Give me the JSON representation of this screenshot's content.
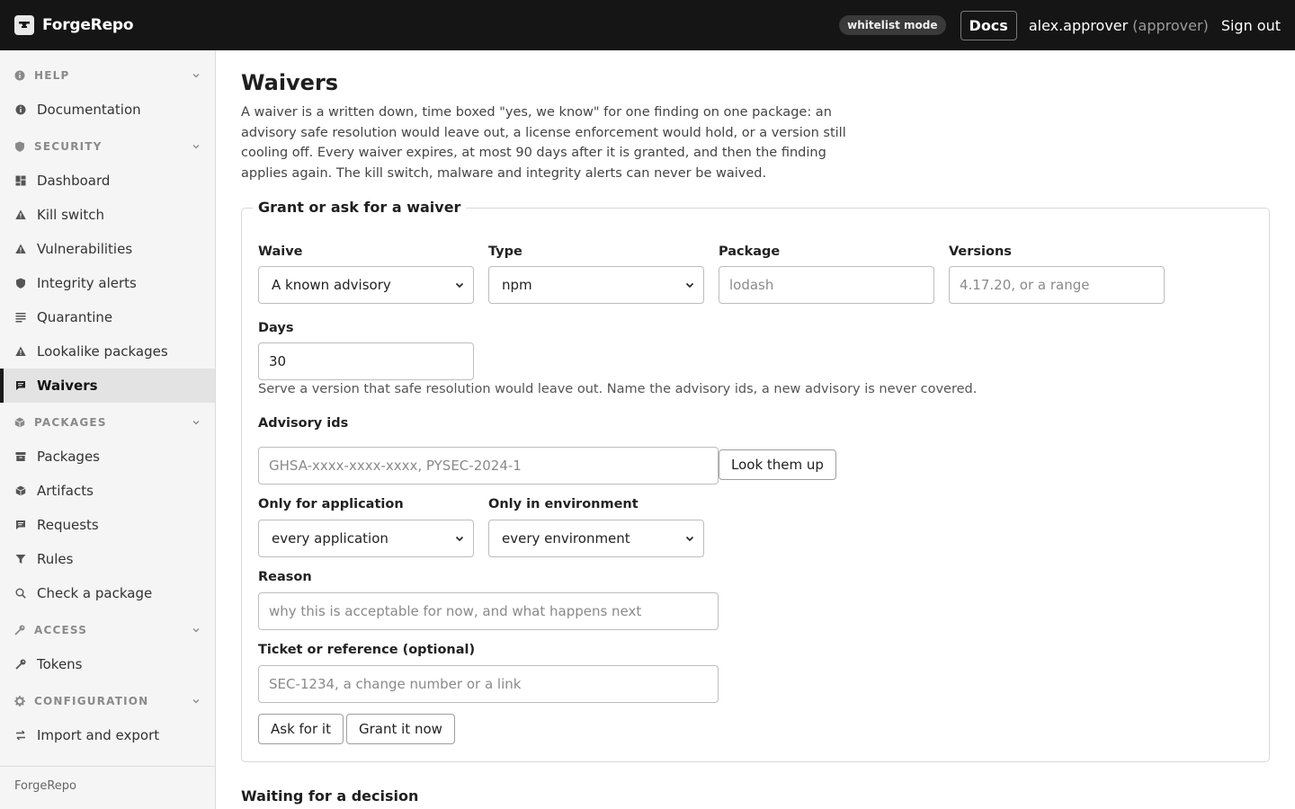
{
  "topbar": {
    "app_name": "ForgeRepo",
    "mode_badge": "whitelist mode",
    "docs_label": "Docs",
    "user_name": "alex.approver",
    "user_role": "(approver)",
    "signout_label": "Sign out"
  },
  "sidebar": {
    "help": {
      "title": "HELP",
      "items": [
        {
          "label": "Documentation",
          "icon": "info-icon"
        }
      ]
    },
    "security": {
      "title": "SECURITY",
      "items": [
        {
          "label": "Dashboard",
          "icon": "dashboard-icon"
        },
        {
          "label": "Kill switch",
          "icon": "warning-icon"
        },
        {
          "label": "Vulnerabilities",
          "icon": "warning-icon"
        },
        {
          "label": "Integrity alerts",
          "icon": "shield-icon"
        },
        {
          "label": "Quarantine",
          "icon": "lines-icon"
        },
        {
          "label": "Lookalike packages",
          "icon": "warning-icon"
        },
        {
          "label": "Waivers",
          "icon": "comment-icon",
          "active": true
        }
      ]
    },
    "packages": {
      "title": "PACKAGES",
      "items": [
        {
          "label": "Packages",
          "icon": "archive-icon"
        },
        {
          "label": "Artifacts",
          "icon": "cube-icon"
        },
        {
          "label": "Requests",
          "icon": "comment-icon"
        },
        {
          "label": "Rules",
          "icon": "filter-icon"
        },
        {
          "label": "Check a package",
          "icon": "search-icon"
        }
      ]
    },
    "access": {
      "title": "ACCESS",
      "items": [
        {
          "label": "Tokens",
          "icon": "key-icon"
        }
      ]
    },
    "configuration": {
      "title": "CONFIGURATION",
      "items": [
        {
          "label": "Import and export",
          "icon": "swap-icon"
        }
      ]
    },
    "footer": "ForgeRepo"
  },
  "main": {
    "title": "Waivers",
    "intro": "A waiver is a written down, time boxed \"yes, we know\" for one finding on one package: an advisory safe resolution would leave out, a license enforcement would hold, or a version still cooling off. Every waiver expires, at most 90 days after it is granted, and then the finding applies again. The kill switch, malware and integrity alerts can never be waived.",
    "form": {
      "legend": "Grant or ask for a waiver",
      "waive_label": "Waive",
      "waive_value": "A known advisory",
      "type_label": "Type",
      "type_value": "npm",
      "package_label": "Package",
      "package_placeholder": "lodash",
      "versions_label": "Versions",
      "versions_placeholder": "4.17.20, or a range",
      "days_label": "Days",
      "days_value": "30",
      "waive_help": "Serve a version that safe resolution would leave out. Name the advisory ids, a new advisory is never covered.",
      "advisory_label": "Advisory ids",
      "advisory_placeholder": "GHSA-xxxx-xxxx-xxxx, PYSEC-2024-1",
      "lookup_label": "Look them up",
      "app_label": "Only for application",
      "app_value": "every application",
      "env_label": "Only in environment",
      "env_value": "every environment",
      "reason_label": "Reason",
      "reason_placeholder": "why this is acceptable for now, and what happens next",
      "ticket_label": "Ticket or reference (optional)",
      "ticket_placeholder": "SEC-1234, a change number or a link",
      "ask_label": "Ask for it",
      "grant_label": "Grant it now"
    },
    "pending_title": "Waiting for a decision"
  }
}
